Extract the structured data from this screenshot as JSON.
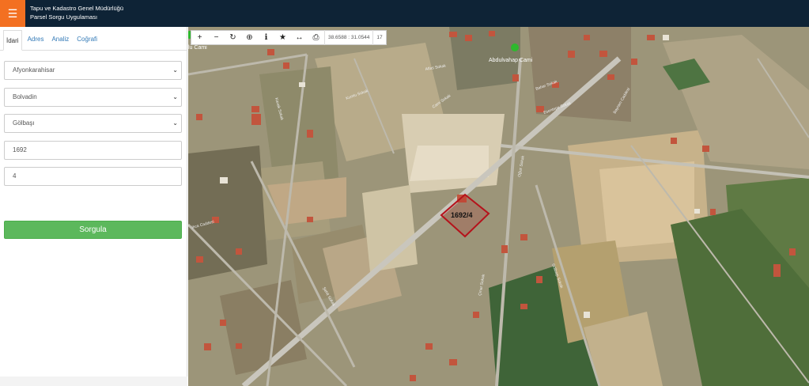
{
  "header": {
    "title_line1": "Tapu ve Kadastro Genel Müdürlüğü",
    "title_line2": "Parsel Sorgu Uygulaması",
    "menu_icon": "hamburger-icon"
  },
  "sidebar": {
    "tabs": [
      {
        "label": "İdari",
        "active": true
      },
      {
        "label": "Adres",
        "active": false
      },
      {
        "label": "Analiz",
        "active": false
      },
      {
        "label": "Coğrafi",
        "active": false
      }
    ],
    "province": "Afyonkarahisar",
    "district": "Bolvadin",
    "neighborhood": "Gölbaşı",
    "block_no": "1692",
    "parcel_no": "4",
    "query_button": "Sorgula"
  },
  "map": {
    "toolbar": {
      "buttons": [
        "zoom-in-icon",
        "zoom-out-icon",
        "refresh-icon",
        "locate-icon",
        "info-icon",
        "star-icon",
        "measure-icon",
        "print-icon"
      ],
      "coordinates": "38.6588 : 31.0544",
      "zoom": "17"
    },
    "parcel_label": "1692/4",
    "poi_label": "Abdulvahap Cami",
    "poi_label_left": "lu Cami",
    "road_labels": [
      "Kumlu Sokak",
      "Atlas Sokak",
      "Cami Sokak",
      "Bahar Sokak",
      "Bayram Caddesi",
      "Esentepe Sokak",
      "Kavak Sokak",
      "Ilıca Caddesi",
      "Gölbaşı Sokak",
      "Çınar Sokak",
      "Oğuz Sokak",
      "Şehit Sokak"
    ],
    "colors": {
      "parcel_outline": "#b5121b",
      "poi": "#2eb82e",
      "header": "#0e2336",
      "accent": "#f37021"
    }
  }
}
